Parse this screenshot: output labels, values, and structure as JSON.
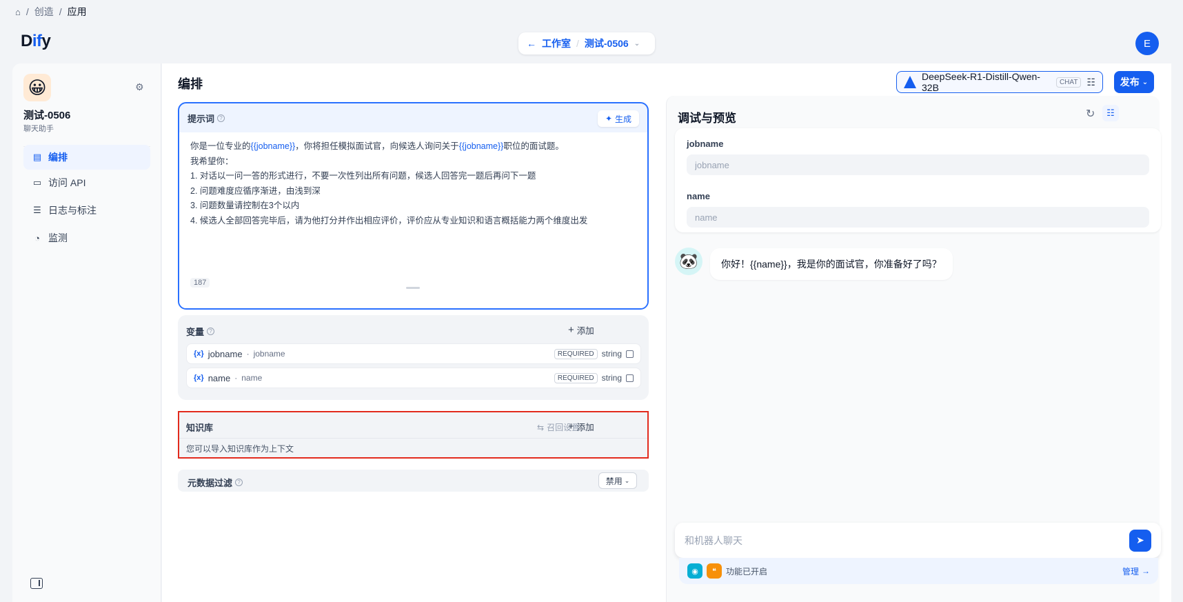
{
  "breadcrumb": {
    "home_icon": "home-icon",
    "items": [
      "创造",
      "应用"
    ]
  },
  "header": {
    "logo": {
      "prefix": "D",
      "accent": "if",
      "suffix": "y"
    },
    "nav": {
      "back_label": "工作室",
      "app_label": "测试-0506"
    },
    "user_initial": "E"
  },
  "sidebar": {
    "app_icon": "😀",
    "app_name": "测试-0506",
    "app_type": "聊天助手",
    "items": [
      {
        "label": "编排",
        "icon": "layout-icon",
        "active": true
      },
      {
        "label": "访问 API",
        "icon": "terminal-icon",
        "active": false
      },
      {
        "label": "日志与标注",
        "icon": "file-list-icon",
        "active": false
      },
      {
        "label": "监测",
        "icon": "gauge-icon",
        "active": false
      }
    ]
  },
  "main": {
    "title": "编排",
    "model": {
      "name": "DeepSeek-R1-Distill-Qwen-32B",
      "tag": "CHAT"
    },
    "publish_label": "发布",
    "prompt": {
      "title": "提示词",
      "generate_label": "生成",
      "lines": {
        "l1a": "你是一位专业的",
        "l1b": "{{jobname}}",
        "l1c": "，你将担任模拟面试官，向候选人询问关于",
        "l1d": "{{jobname}}",
        "l1e": "职位的面试题。",
        "l2": "我希望你：",
        "l3": "1. 对话以一问一答的形式进行，不要一次性列出所有问题，候选人回答完一题后再问下一题",
        "l4": "2. 问题难度应循序渐进，由浅到深",
        "l5": "3. 问题数量请控制在3个以内",
        "l6": "4. 候选人全部回答完毕后，请为他打分并作出相应评价，评价应从专业知识和语言概括能力两个维度出发"
      },
      "char_count": "187"
    },
    "variables": {
      "title": "变量",
      "add_label": "添加",
      "rows": [
        {
          "key": "jobname",
          "label": "jobname",
          "required": "REQUIRED",
          "type": "string"
        },
        {
          "key": "name",
          "label": "name",
          "required": "REQUIRED",
          "type": "string"
        }
      ]
    },
    "knowledge": {
      "title": "知识库",
      "recall_label": "召回设置",
      "add_label": "添加",
      "hint": "您可以导入知识库作为上下文"
    },
    "metadata": {
      "title": "元数据过滤",
      "select_value": "禁用"
    }
  },
  "debug": {
    "title": "调试与预览",
    "fields": [
      {
        "label": "jobname",
        "placeholder": "jobname"
      },
      {
        "label": "name",
        "placeholder": "name"
      }
    ],
    "bot_avatar": "🐼",
    "message": "你好！{{name}}，我是你的面试官，你准备好了吗？",
    "chat_placeholder": "和机器人聊天",
    "features_text": "功能已开启",
    "manage_label": "管理"
  },
  "colors": {
    "accent": "#155eef",
    "highlight_border": "#e22a1d"
  }
}
